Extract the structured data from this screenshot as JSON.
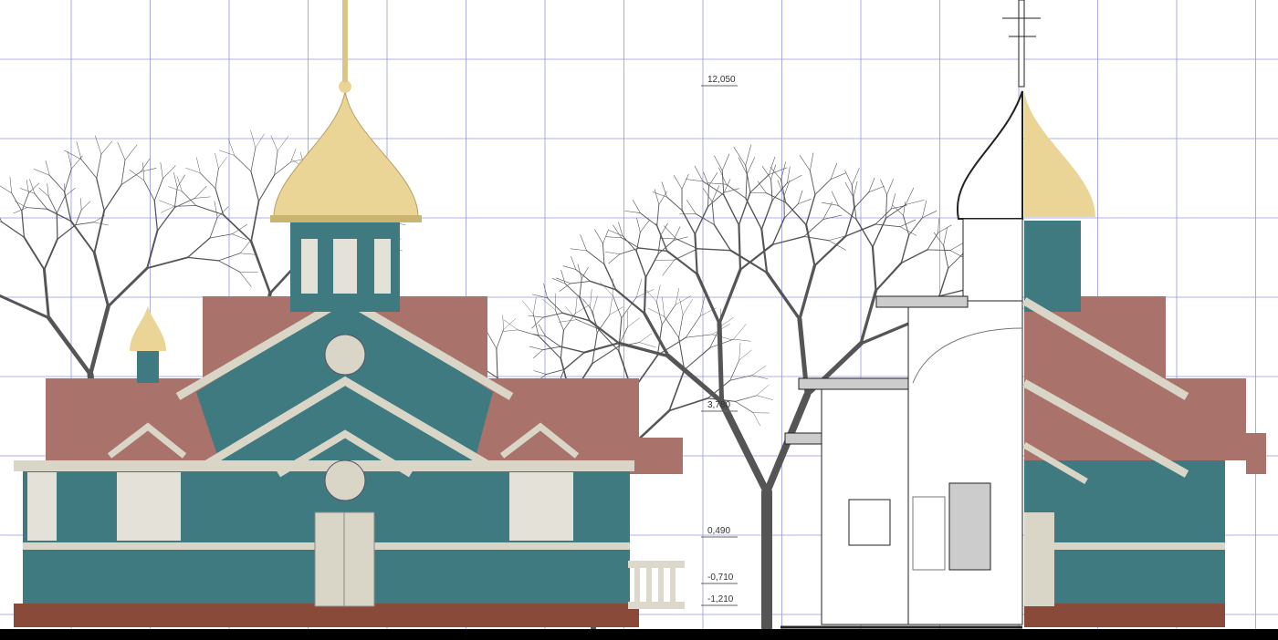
{
  "elevation_marks": [
    "12,050",
    "3,780",
    "0,490",
    "-0,710",
    "-1,210"
  ],
  "colors": {
    "wall": "#3e7a80",
    "roof": "#a9736b",
    "dome": "#ead597",
    "trim": "#d9d6c8",
    "grid": "#6a6ad8",
    "tree": "#555555",
    "base": "#8a4a3a"
  }
}
